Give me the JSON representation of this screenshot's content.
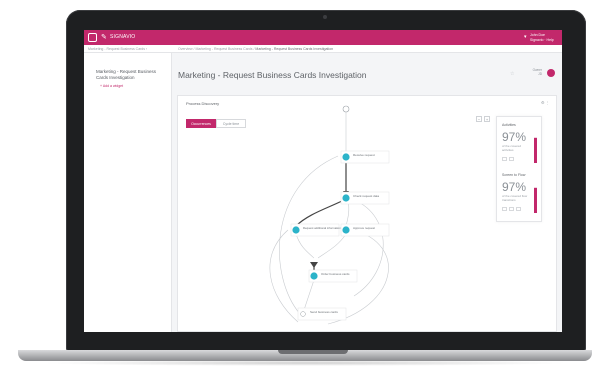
{
  "app": {
    "brand": "SIGNAVIO",
    "user_name": "John Doe",
    "user_org": "Signavio · Help"
  },
  "breadcrumbs": {
    "left": "Marketing - Request Business Cards",
    "right_prefix": "Overview / Marketing - Request Business Cards / ",
    "right_current": "Marketing - Request Business Cards Investigation"
  },
  "sidebar": {
    "title": "Marketing - Request Business Cards Investigation",
    "link": "+ Add a widget"
  },
  "page": {
    "title": "Marketing - Request Business Cards Investigation",
    "owner_label": "Owner",
    "owner_value": "JD"
  },
  "panel": {
    "title": "Process Discovery",
    "menu": "⚙ ⋮",
    "toggle": [
      "Occurrences",
      "Cycle time"
    ],
    "zoom": [
      "−",
      "+"
    ]
  },
  "flow_nodes": [
    {
      "id": "n1",
      "label": "Receive request"
    },
    {
      "id": "n2",
      "label": "Check request data"
    },
    {
      "id": "n3",
      "label": "Request additional information"
    },
    {
      "id": "n4",
      "label": "Approve request"
    },
    {
      "id": "n5",
      "label": "Order business cards"
    },
    {
      "id": "n6",
      "label": "Send business cards"
    }
  ],
  "metrics": [
    {
      "label": "Activities",
      "pct": "97%",
      "desc": "of the covered activities",
      "fill": 0.97
    },
    {
      "label": "Screen to Flow",
      "pct": "97%",
      "desc": "of the covered flow transitions",
      "fill": 0.97
    }
  ],
  "colors": {
    "accent": "#c2286b",
    "node": "#2bb3c9"
  }
}
